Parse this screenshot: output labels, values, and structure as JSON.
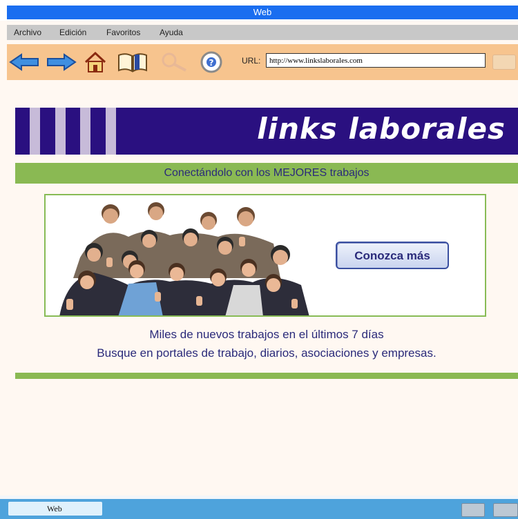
{
  "window": {
    "title": "Web"
  },
  "menu": {
    "items": [
      "Archivo",
      "Edición",
      "Favoritos",
      "Ayuda"
    ]
  },
  "toolbar": {
    "icons": [
      "back-arrow-icon",
      "forward-arrow-icon",
      "home-icon",
      "bookmarks-book-icon",
      "search-magnifier-icon",
      "help-lifebuoy-icon"
    ],
    "url_label": "URL:",
    "url_value": "http://www.linkslaborales.com"
  },
  "page": {
    "brand": "links laborales",
    "tagline": "Conectándolo con los MEJORES trabajos",
    "cta_label": "Conozca más",
    "info_line1": "Miles de nuevos trabajos en el últimos 7 días",
    "info_line2": "Busque en portales de trabajo, diarios, asociaciones y empresas."
  },
  "taskbar": {
    "button_label": "Web"
  },
  "colors": {
    "title_blue": "#1a6ef0",
    "toolbar_peach": "#f7c48e",
    "banner_purple": "#2a1080",
    "accent_green": "#8ab953",
    "text_navy": "#2a2a7a"
  }
}
